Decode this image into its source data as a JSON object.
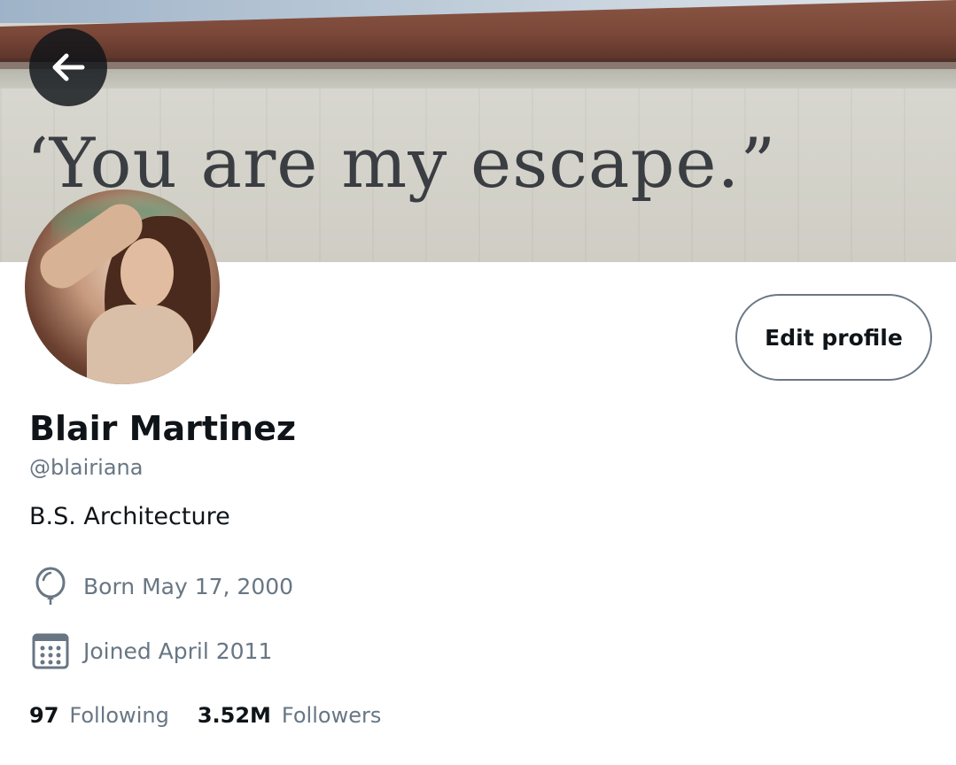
{
  "banner": {
    "quote": "‘You are my escape.”"
  },
  "nav": {
    "back_icon": "arrow-left-icon"
  },
  "profile": {
    "name": "Blair Martinez",
    "handle": "@blairiana",
    "bio": "B.S. Architecture",
    "edit_label": "Edit profile",
    "born": "Born May 17, 2000",
    "joined": "Joined April 2011",
    "born_icon": "balloon-icon",
    "joined_icon": "calendar-icon"
  },
  "stats": {
    "following_count": "97",
    "following_label": "Following",
    "followers_count": "3.52M",
    "followers_label": "Followers"
  },
  "colors": {
    "secondary_text": "#687684",
    "primary_text": "#0f1419",
    "button_border": "#6b7885"
  }
}
